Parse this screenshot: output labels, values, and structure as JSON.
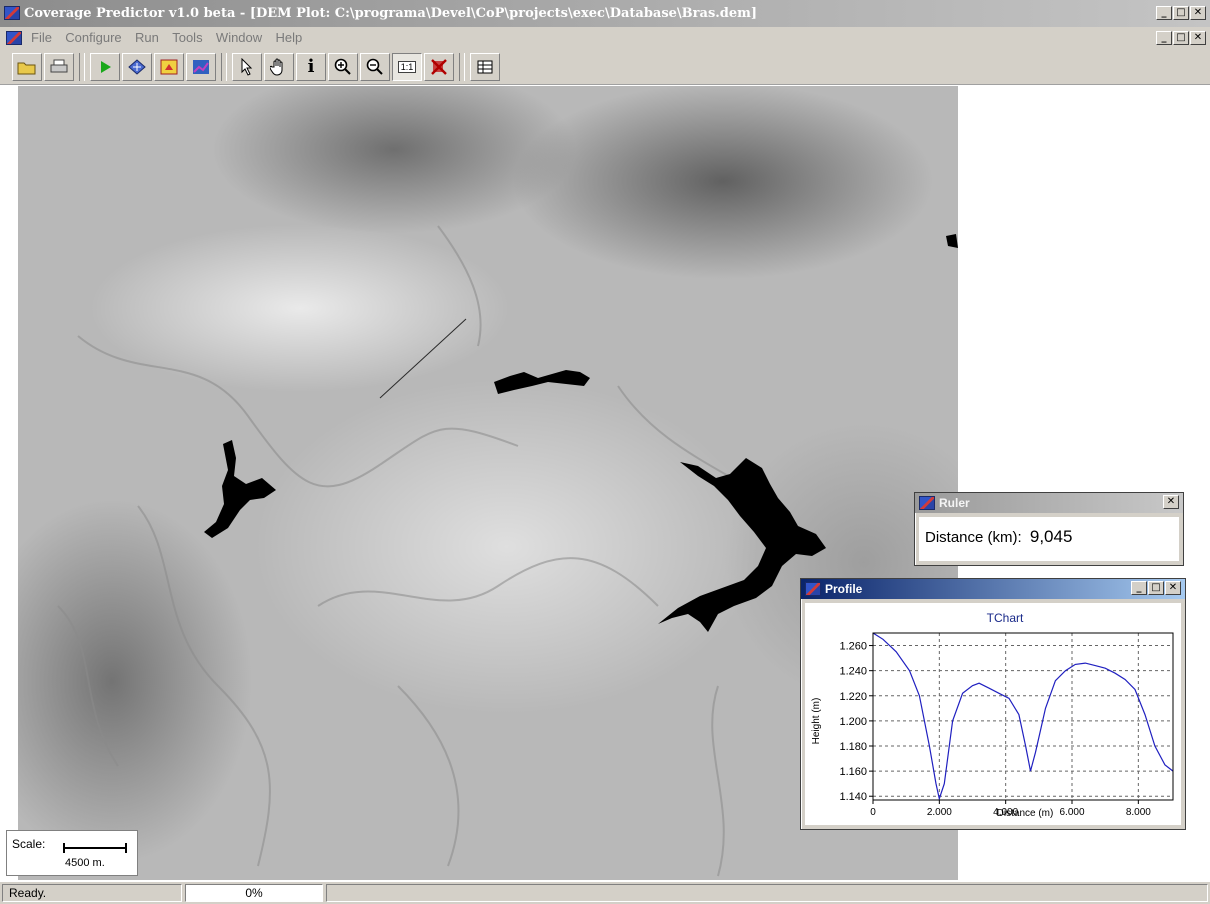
{
  "window": {
    "title": "Coverage Predictor v1.0 beta - [DEM Plot: C:\\programa\\Devel\\CoP\\projects\\exec\\Database\\Bras.dem]"
  },
  "menu": [
    "File",
    "Configure",
    "Run",
    "Tools",
    "Window",
    "Help"
  ],
  "toolbar": {
    "buttons": [
      "open-folder",
      "print",
      "run",
      "layers",
      "select-area",
      "coverage",
      "pointer",
      "pan-hand",
      "info",
      "zoom-in",
      "zoom-out",
      "zoom-fit",
      "clear",
      "grid"
    ],
    "pressed": "zoom-fit",
    "info_glyph": "i",
    "zoom_fit_glyph": "1:1"
  },
  "scale": {
    "label": "Scale:",
    "value": "4500 m."
  },
  "status": {
    "message": "Ready.",
    "progress": "0%"
  },
  "ruler": {
    "title": "Ruler",
    "distance_label": "Distance (km):",
    "distance_value": "9,045"
  },
  "profile": {
    "title": "Profile",
    "chart_data": {
      "type": "line",
      "title": "TChart",
      "xlabel": "Distance (m)",
      "ylabel": "Height (m)",
      "xlim": [
        0,
        9045
      ],
      "ylim": [
        1.137,
        1.27
      ],
      "x_ticks": [
        0,
        2000,
        4000,
        6000,
        8000
      ],
      "x_tick_labels": [
        "0",
        "2.000",
        "4.000",
        "6.000",
        "8.000"
      ],
      "y_ticks": [
        1.14,
        1.16,
        1.18,
        1.2,
        1.22,
        1.24,
        1.26
      ],
      "y_tick_labels": [
        "1.140",
        "1.160",
        "1.180",
        "1.200",
        "1.220",
        "1.240",
        "1.260"
      ],
      "grid": true,
      "series": [
        {
          "color": "#2020c0",
          "x": [
            0,
            300,
            700,
            1100,
            1400,
            1700,
            1900,
            2000,
            2150,
            2400,
            2700,
            3000,
            3200,
            3500,
            3800,
            4100,
            4400,
            4600,
            4750,
            4900,
            5200,
            5500,
            5800,
            6100,
            6400,
            6700,
            7000,
            7300,
            7600,
            7900,
            8200,
            8500,
            8800,
            9045
          ],
          "y": [
            1.27,
            1.265,
            1.255,
            1.24,
            1.22,
            1.18,
            1.15,
            1.138,
            1.15,
            1.2,
            1.222,
            1.228,
            1.23,
            1.226,
            1.222,
            1.218,
            1.205,
            1.18,
            1.16,
            1.175,
            1.21,
            1.232,
            1.24,
            1.245,
            1.246,
            1.244,
            1.242,
            1.238,
            1.233,
            1.225,
            1.205,
            1.18,
            1.165,
            1.16
          ]
        }
      ]
    }
  }
}
